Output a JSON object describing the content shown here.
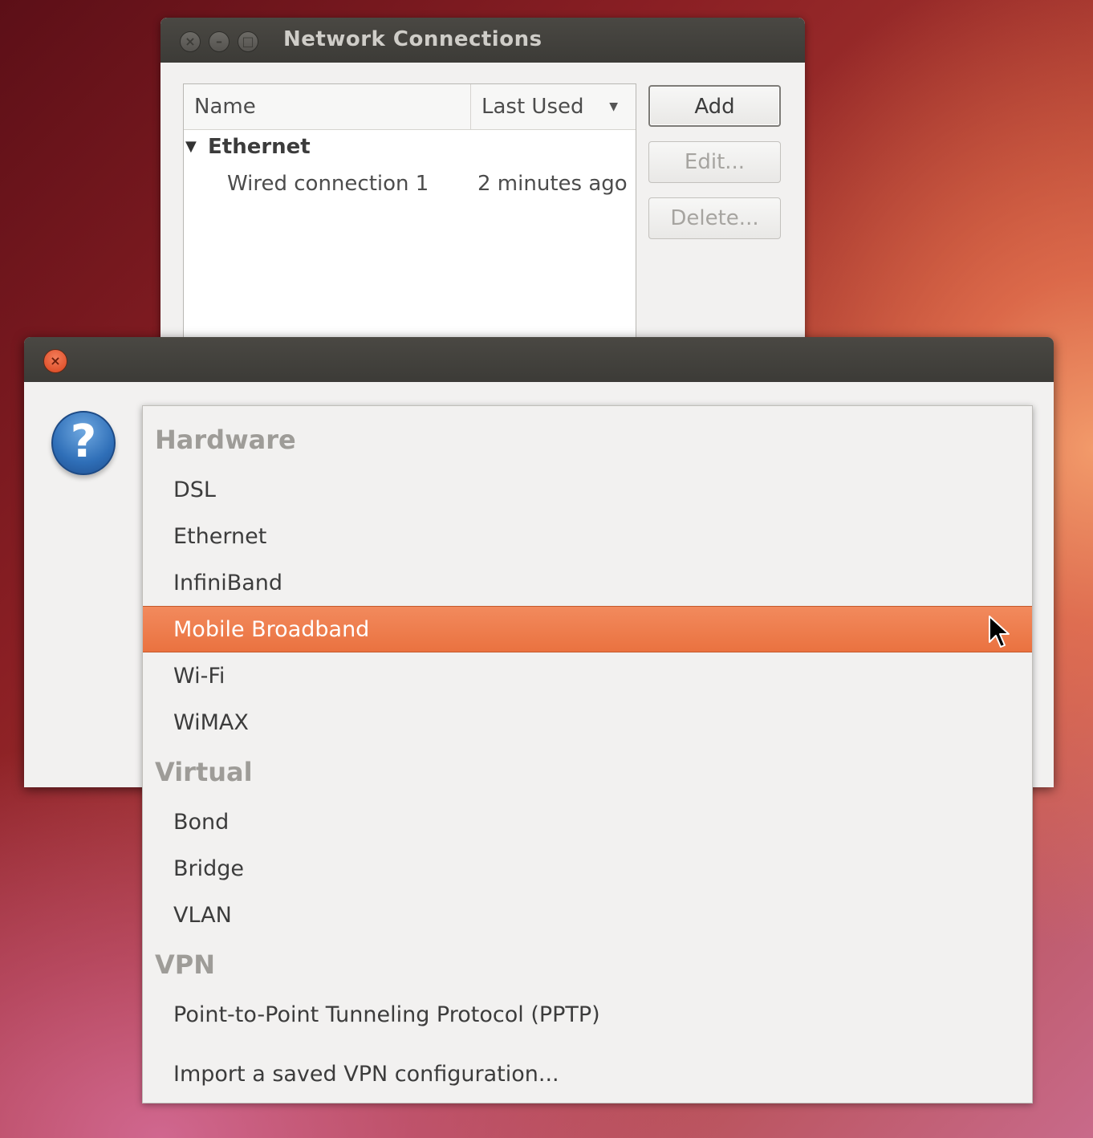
{
  "network_window": {
    "title": "Network Connections",
    "columns": {
      "name": "Name",
      "last_used": "Last Used"
    },
    "group": "Ethernet",
    "connections": [
      {
        "name": "Wired connection 1",
        "last_used": "2 minutes ago"
      }
    ],
    "buttons": {
      "add": "Add",
      "edit": "Edit...",
      "delete": "Delete..."
    }
  },
  "dialog": {
    "icon": "question-icon",
    "menu": {
      "sections": [
        {
          "label": "Hardware",
          "items": [
            "DSL",
            "Ethernet",
            "InfiniBand",
            "Mobile Broadband",
            "Wi-Fi",
            "WiMAX"
          ]
        },
        {
          "label": "Virtual",
          "items": [
            "Bond",
            "Bridge",
            "VLAN"
          ]
        },
        {
          "label": "VPN",
          "items": [
            "Point-to-Point Tunneling Protocol (PPTP)",
            "Import a saved VPN configuration..."
          ]
        }
      ],
      "highlighted": "Mobile Broadband"
    }
  },
  "colors": {
    "highlight": "#ea7240",
    "titlebar": "#3c3b37",
    "close_button": "#d9441d"
  }
}
